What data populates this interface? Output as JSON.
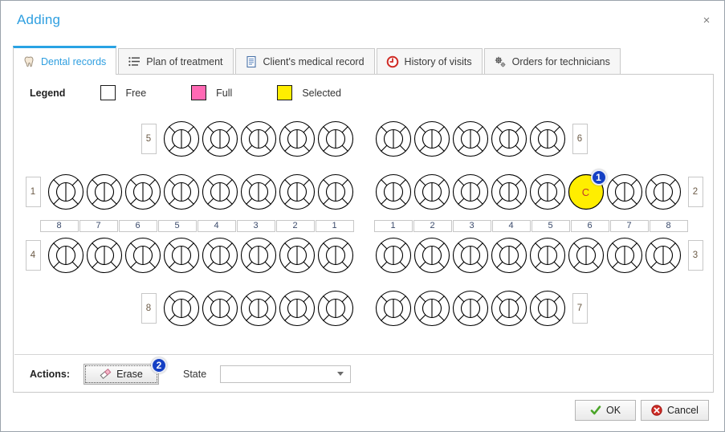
{
  "window": {
    "title": "Adding",
    "close_label": "×"
  },
  "tabs": [
    {
      "label": "Dental records",
      "icon": "tooth-icon",
      "active": true
    },
    {
      "label": "Plan of treatment",
      "icon": "list-icon",
      "active": false
    },
    {
      "label": "Client's medical record",
      "icon": "document-icon",
      "active": false
    },
    {
      "label": "History of visits",
      "icon": "history-icon",
      "active": false
    },
    {
      "label": "Orders for technicians",
      "icon": "gears-icon",
      "active": false
    }
  ],
  "legend": {
    "title": "Legend",
    "items": [
      {
        "label": "Free",
        "color": "#ffffff"
      },
      {
        "label": "Full",
        "color": "#ff69b4"
      },
      {
        "label": "Selected",
        "color": "#ffee00"
      }
    ]
  },
  "chart": {
    "rows": [
      {
        "name": "upper-deciduous",
        "left_quadrant": "5",
        "right_quadrant": "6",
        "left_teeth": [
          {
            "state": "free"
          },
          {
            "state": "free"
          },
          {
            "state": "free"
          },
          {
            "state": "free"
          },
          {
            "state": "free"
          }
        ],
        "right_teeth": [
          {
            "state": "free"
          },
          {
            "state": "free"
          },
          {
            "state": "free"
          },
          {
            "state": "free"
          },
          {
            "state": "free"
          }
        ]
      },
      {
        "name": "upper-permanent",
        "left_quadrant": "1",
        "right_quadrant": "2",
        "left_teeth": [
          {
            "state": "free"
          },
          {
            "state": "free"
          },
          {
            "state": "free"
          },
          {
            "state": "free"
          },
          {
            "state": "free"
          },
          {
            "state": "free"
          },
          {
            "state": "free"
          },
          {
            "state": "free"
          }
        ],
        "right_teeth": [
          {
            "state": "free"
          },
          {
            "state": "free"
          },
          {
            "state": "free"
          },
          {
            "state": "free"
          },
          {
            "state": "free"
          },
          {
            "state": "selected",
            "letter": "C",
            "badge": "1"
          },
          {
            "state": "free"
          },
          {
            "state": "free"
          }
        ]
      },
      {
        "name": "lower-permanent",
        "left_quadrant": "4",
        "right_quadrant": "3",
        "left_teeth": [
          {
            "state": "free"
          },
          {
            "state": "free"
          },
          {
            "state": "free"
          },
          {
            "state": "free"
          },
          {
            "state": "free"
          },
          {
            "state": "free"
          },
          {
            "state": "free"
          },
          {
            "state": "free"
          }
        ],
        "right_teeth": [
          {
            "state": "free"
          },
          {
            "state": "free"
          },
          {
            "state": "free"
          },
          {
            "state": "free"
          },
          {
            "state": "free"
          },
          {
            "state": "free"
          },
          {
            "state": "free"
          },
          {
            "state": "free"
          }
        ]
      },
      {
        "name": "lower-deciduous",
        "left_quadrant": "8",
        "right_quadrant": "7",
        "left_teeth": [
          {
            "state": "free"
          },
          {
            "state": "free"
          },
          {
            "state": "free"
          },
          {
            "state": "free"
          },
          {
            "state": "free"
          }
        ],
        "right_teeth": [
          {
            "state": "free"
          },
          {
            "state": "free"
          },
          {
            "state": "free"
          },
          {
            "state": "free"
          },
          {
            "state": "free"
          }
        ]
      }
    ],
    "numbers_left": [
      "8",
      "7",
      "6",
      "5",
      "4",
      "3",
      "2",
      "1"
    ],
    "numbers_right": [
      "1",
      "2",
      "3",
      "4",
      "5",
      "6",
      "7",
      "8"
    ]
  },
  "actions": {
    "label": "Actions:",
    "erase_label": "Erase",
    "erase_badge": "2",
    "state_label": "State",
    "state_value": "",
    "state_placeholder": ""
  },
  "footer": {
    "ok_label": "OK",
    "cancel_label": "Cancel"
  }
}
